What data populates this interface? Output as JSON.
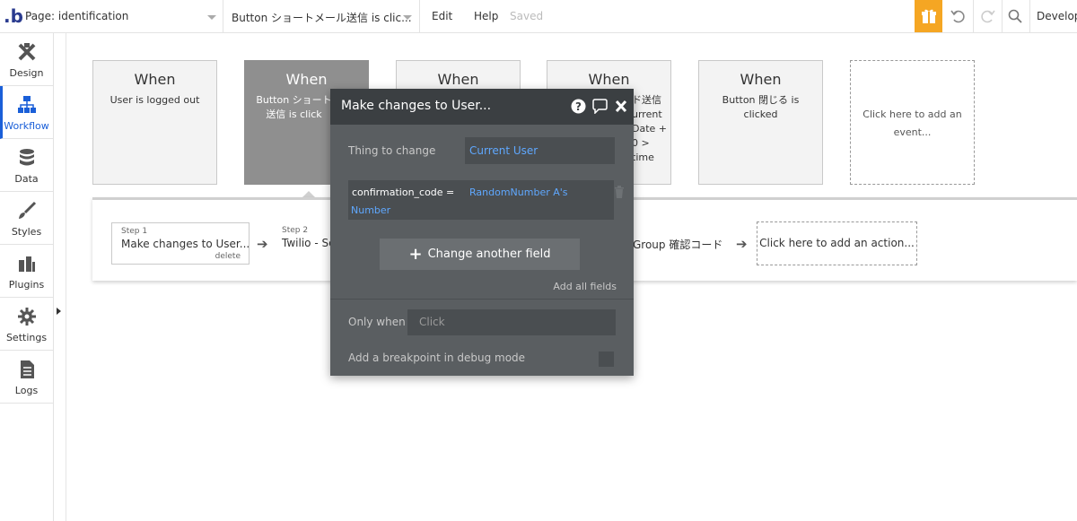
{
  "topbar": {
    "logo": ".b",
    "page_select": "Page: identification",
    "event_select": "Button ショートメール送信 is clic...",
    "menu_edit": "Edit",
    "menu_help": "Help",
    "status": "Saved",
    "env": "Develop",
    "accent_color": "#f5a623"
  },
  "sidebar": {
    "items": [
      {
        "label": "Design",
        "icon": "design-icon"
      },
      {
        "label": "Workflow",
        "icon": "workflow-icon",
        "active": true
      },
      {
        "label": "Data",
        "icon": "database-icon"
      },
      {
        "label": "Styles",
        "icon": "brush-icon"
      },
      {
        "label": "Plugins",
        "icon": "plugin-icon"
      },
      {
        "label": "Settings",
        "icon": "gear-icon"
      },
      {
        "label": "Logs",
        "icon": "document-icon"
      }
    ]
  },
  "events": [
    {
      "when": "When",
      "desc": "User is logged out"
    },
    {
      "when": "When",
      "desc": "Button ショート 送信 is click"
    },
    {
      "when": "When",
      "desc": ""
    },
    {
      "when": "When",
      "desc": "ド送信 urrent Date + 0 > time"
    },
    {
      "when": "When",
      "desc": "Button 閉じる is clicked"
    },
    {
      "add_label": "Click here to add an event..."
    }
  ],
  "actions": {
    "step1": {
      "num": "Step 1",
      "name": "Make changes to User...",
      "delete": "delete"
    },
    "step2": {
      "num": "Step 2",
      "name": "Twilio - Se"
    },
    "step_group": "Group 確認コード",
    "add_action": "Click here to add an action..."
  },
  "modal": {
    "title": "Make changes to User...",
    "thing_label": "Thing to change",
    "thing_value": "Current User",
    "field_key": "confirmation_code =",
    "field_value_1": "RandomNumber A's",
    "field_value_2": "Number",
    "change_btn": "Change another field",
    "add_all": "Add all fields",
    "only_when_label": "Only when",
    "only_when_placeholder": "Click",
    "breakpoint_label": "Add a breakpoint in debug mode",
    "link_color": "#5fa8ff"
  }
}
